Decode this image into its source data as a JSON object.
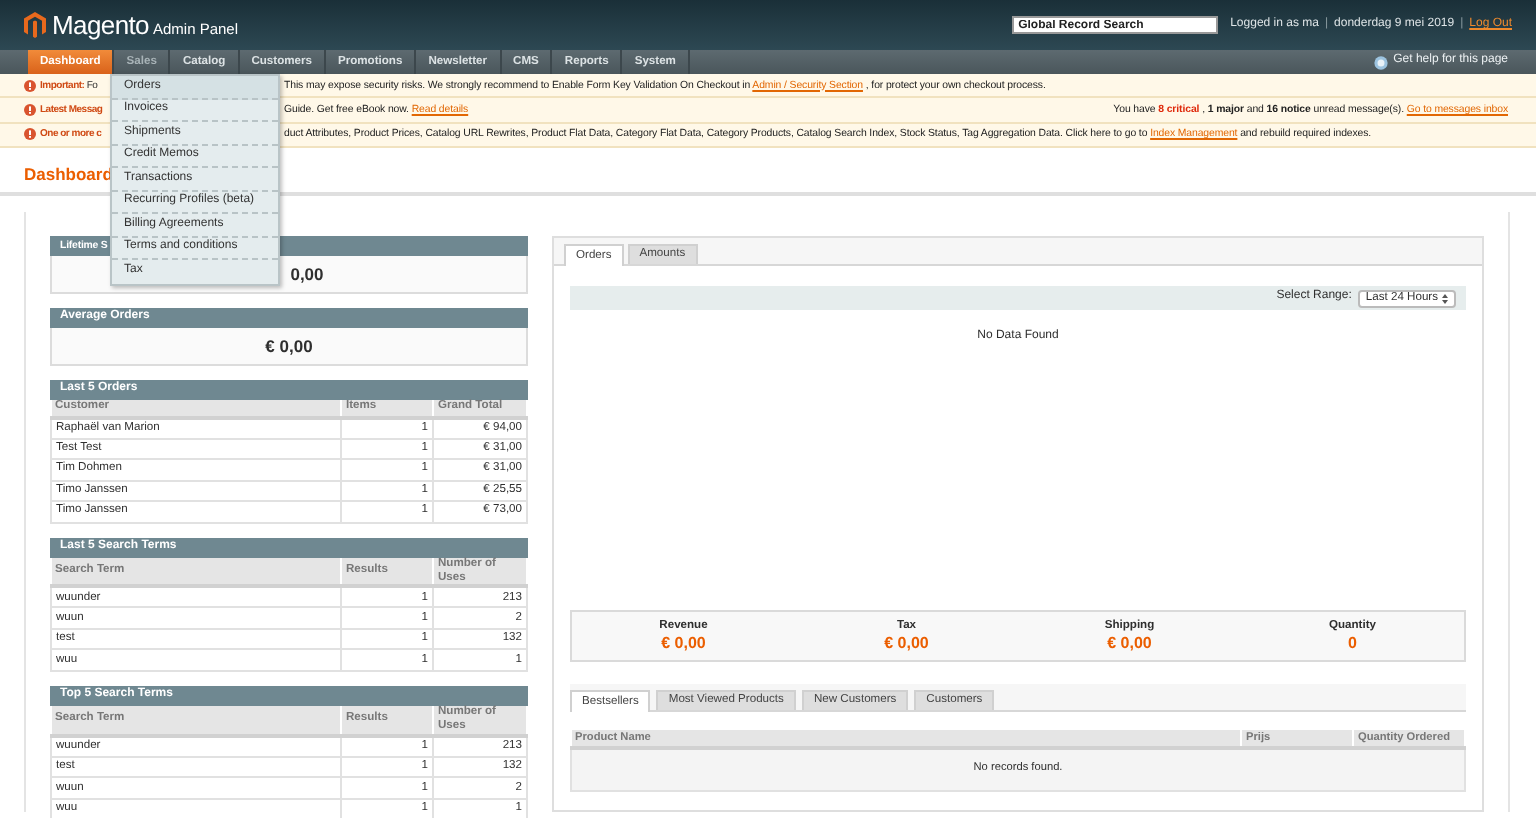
{
  "header": {
    "logo": "Magento",
    "logo_sub": "Admin Panel",
    "search": {
      "value": "Global Record Search"
    },
    "user_info": "Logged in as ma",
    "separators": [
      "|",
      "|"
    ],
    "date": "donderdag 9 mei 2019",
    "logout": "Log Out"
  },
  "nav": {
    "items": [
      {
        "label": "Dashboard",
        "selected": true,
        "expanded": false
      },
      {
        "label": "Sales",
        "selected": false,
        "expanded": true
      },
      {
        "label": "Catalog",
        "selected": false,
        "expanded": false
      },
      {
        "label": "Customers",
        "selected": false,
        "expanded": false
      },
      {
        "label": "Promotions",
        "selected": false,
        "expanded": false
      },
      {
        "label": "Newsletter",
        "selected": false,
        "expanded": false
      },
      {
        "label": "CMS",
        "selected": false,
        "expanded": false
      },
      {
        "label": "Reports",
        "selected": false,
        "expanded": false
      },
      {
        "label": "System",
        "selected": false,
        "expanded": false
      }
    ],
    "help": "Get help for this page"
  },
  "dropdown": {
    "items": [
      {
        "label": "Orders",
        "selected": true
      },
      {
        "label": "Invoices",
        "selected": false
      },
      {
        "label": "Shipments",
        "selected": false
      },
      {
        "label": "Credit Memos",
        "selected": false
      },
      {
        "label": "Transactions",
        "selected": false
      },
      {
        "label": "Recurring Profiles (beta)",
        "selected": false
      },
      {
        "label": "Billing Agreements",
        "selected": false
      },
      {
        "label": "Terms and conditions",
        "selected": false
      },
      {
        "label": "Tax",
        "selected": false
      }
    ]
  },
  "notices": [
    {
      "lead": "Important:",
      "lead_rest": "Fo",
      "text": [
        {
          "kind": "plain",
          "text": "This may expose security risks. We strongly recommend to Enable Form Key Validation On Checkout in"
        },
        {
          "kind": "link",
          "text": "Admin / Security Section"
        },
        {
          "kind": "plain",
          "text": ", for protect your own checkout process."
        }
      ]
    },
    {
      "lead": "Latest Messag",
      "text": [
        {
          "kind": "plain",
          "text": "Guide. Get free eBook now."
        },
        {
          "kind": "link",
          "text": "Read details"
        }
      ],
      "right": [
        {
          "kind": "plain",
          "text": "You have"
        },
        {
          "kind": "critical",
          "text": "8 critical"
        },
        {
          "kind": "plain",
          "text": ", **1 major** and **16 notice** unread message(s)."
        },
        {
          "kind": "link",
          "text": "Go to messages inbox"
        }
      ]
    },
    {
      "lead": "One or more c",
      "text": [
        {
          "kind": "plain",
          "text": "duct Attributes, Product Prices, Catalog URL Rewrites, Product Flat Data, Category Flat Data, Category Products, Catalog Search Index, Stock Status, Tag Aggregation Data. Click here to go to"
        },
        {
          "kind": "link",
          "text": "Index Management"
        },
        {
          "kind": "plain",
          "text": "and rebuild required indexes."
        }
      ]
    }
  ],
  "page_title": "Dashboard",
  "stats": [
    {
      "kind": "clipped",
      "title": "Lifetime S",
      "value": "0,00"
    },
    {
      "kind": "full",
      "title": "Average Orders",
      "value": "€ 0,00"
    }
  ],
  "tables": [
    {
      "title": "Last 5 Orders",
      "columns": [
        "Customer",
        "Items",
        "Grand Total"
      ],
      "rows": [
        [
          "Raphaël van Marion",
          "1",
          "€ 94,00"
        ],
        [
          "Test Test",
          "1",
          "€ 31,00"
        ],
        [
          "Tim Dohmen",
          "1",
          "€ 31,00"
        ],
        [
          "Timo Janssen",
          "1",
          "€ 25,55"
        ],
        [
          "Timo Janssen",
          "1",
          "€ 73,00"
        ]
      ]
    },
    {
      "title": "Last 5 Search Terms",
      "columns": [
        "Search Term",
        "Results",
        "Number of Uses"
      ],
      "rows": [
        [
          "wuunder",
          "1",
          "213"
        ],
        [
          "wuun",
          "1",
          "2"
        ],
        [
          "test",
          "1",
          "132"
        ],
        [
          "wuu",
          "1",
          "1"
        ]
      ]
    },
    {
      "title": "Top 5 Search Terms",
      "columns": [
        "Search Term",
        "Results",
        "Number of Uses"
      ],
      "rows": [
        [
          "wuunder",
          "1",
          "213"
        ],
        [
          "test",
          "1",
          "132"
        ],
        [
          "wuun",
          "1",
          "2"
        ],
        [
          "wuu",
          "1",
          "1"
        ]
      ]
    }
  ],
  "chart_panel": {
    "tabs": [
      {
        "label": "Orders",
        "selected": true
      },
      {
        "label": "Amounts",
        "selected": false
      }
    ],
    "range_label": "Select Range:",
    "range_value": "Last 24 Hours",
    "empty": "No Data Found"
  },
  "totals": [
    {
      "label": "Revenue",
      "value": "€ 0,00"
    },
    {
      "label": "Tax",
      "value": "€ 0,00"
    },
    {
      "label": "Shipping",
      "value": "€ 0,00"
    },
    {
      "label": "Quantity",
      "value": "0"
    }
  ],
  "grid_panel": {
    "tabs": [
      {
        "label": "Bestsellers",
        "selected": true
      },
      {
        "label": "Most Viewed Products",
        "selected": false
      },
      {
        "label": "New Customers",
        "selected": false
      },
      {
        "label": "Customers",
        "selected": false
      }
    ],
    "columns": [
      "Product Name",
      "Prijs",
      "Quantity Ordered"
    ],
    "empty": "No records found."
  }
}
